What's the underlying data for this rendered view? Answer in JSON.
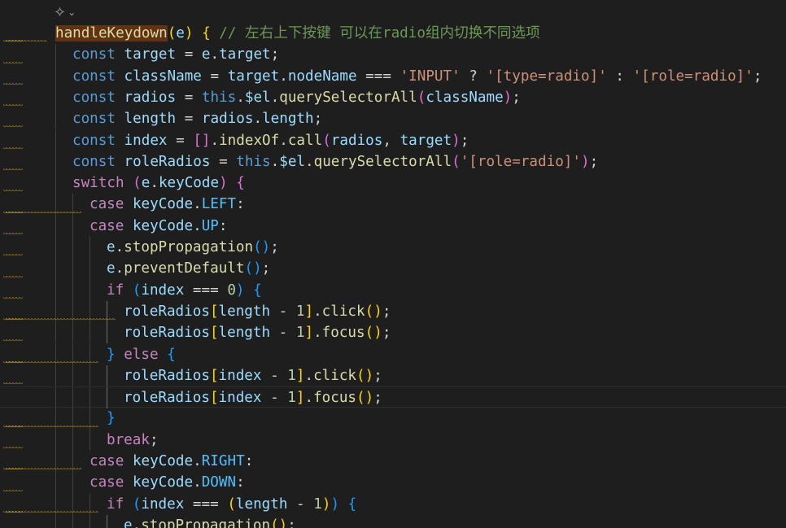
{
  "editor": {
    "fold_icon": "sparkle-icon",
    "fold_chevron": "chevron-down-icon",
    "lines": [
      {
        "indent": 1,
        "squig": "both",
        "tokens": [
          {
            "t": "handleKeydown",
            "c": "fn hl"
          },
          {
            "t": "(",
            "c": "br1"
          },
          {
            "t": "e",
            "c": "var"
          },
          {
            "t": ")",
            "c": "br1"
          },
          {
            "t": " ",
            "c": "op"
          },
          {
            "t": "{",
            "c": "br1"
          },
          {
            "t": " // 左右上下按键 可以在radio组内切换不同选项",
            "c": "com"
          }
        ]
      },
      {
        "indent": 2,
        "squig": "ln",
        "tokens": [
          {
            "t": "const",
            "c": "kw"
          },
          {
            "t": " target ",
            "c": "var"
          },
          {
            "t": "= ",
            "c": "op"
          },
          {
            "t": "e",
            "c": "var"
          },
          {
            "t": ".",
            "c": "op"
          },
          {
            "t": "target",
            "c": "var"
          },
          {
            "t": ";",
            "c": "op"
          }
        ]
      },
      {
        "indent": 2,
        "squig": "ln",
        "tokens": [
          {
            "t": "const",
            "c": "kw"
          },
          {
            "t": " className ",
            "c": "var"
          },
          {
            "t": "= ",
            "c": "op"
          },
          {
            "t": "target",
            "c": "var"
          },
          {
            "t": ".",
            "c": "op"
          },
          {
            "t": "nodeName",
            "c": "var"
          },
          {
            "t": " === ",
            "c": "op"
          },
          {
            "t": "'INPUT'",
            "c": "str"
          },
          {
            "t": " ? ",
            "c": "op"
          },
          {
            "t": "'[type=radio]'",
            "c": "str"
          },
          {
            "t": " : ",
            "c": "op"
          },
          {
            "t": "'[role=radio]'",
            "c": "str"
          },
          {
            "t": ";",
            "c": "op"
          }
        ]
      },
      {
        "indent": 2,
        "squig": "ln",
        "tokens": [
          {
            "t": "const",
            "c": "kw"
          },
          {
            "t": " radios ",
            "c": "var"
          },
          {
            "t": "= ",
            "c": "op"
          },
          {
            "t": "this",
            "c": "kw"
          },
          {
            "t": ".",
            "c": "op"
          },
          {
            "t": "$el",
            "c": "var"
          },
          {
            "t": ".",
            "c": "op"
          },
          {
            "t": "querySelectorAll",
            "c": "fn"
          },
          {
            "t": "(",
            "c": "br2"
          },
          {
            "t": "className",
            "c": "var"
          },
          {
            "t": ")",
            "c": "br2"
          },
          {
            "t": ";",
            "c": "op"
          }
        ]
      },
      {
        "indent": 2,
        "squig": "ln",
        "tokens": [
          {
            "t": "const",
            "c": "kw"
          },
          {
            "t": " length ",
            "c": "var"
          },
          {
            "t": "= ",
            "c": "op"
          },
          {
            "t": "radios",
            "c": "var"
          },
          {
            "t": ".",
            "c": "op"
          },
          {
            "t": "length",
            "c": "var"
          },
          {
            "t": ";",
            "c": "op"
          }
        ]
      },
      {
        "indent": 2,
        "squig": "ln",
        "tokens": [
          {
            "t": "const",
            "c": "kw"
          },
          {
            "t": " index ",
            "c": "var"
          },
          {
            "t": "= ",
            "c": "op"
          },
          {
            "t": "[]",
            "c": "br2"
          },
          {
            "t": ".",
            "c": "op"
          },
          {
            "t": "indexOf",
            "c": "fn"
          },
          {
            "t": ".",
            "c": "op"
          },
          {
            "t": "call",
            "c": "fn"
          },
          {
            "t": "(",
            "c": "br2"
          },
          {
            "t": "radios",
            "c": "var"
          },
          {
            "t": ", ",
            "c": "op"
          },
          {
            "t": "target",
            "c": "var"
          },
          {
            "t": ")",
            "c": "br2"
          },
          {
            "t": ";",
            "c": "op"
          }
        ]
      },
      {
        "indent": 2,
        "squig": "ln",
        "tokens": [
          {
            "t": "const",
            "c": "kw"
          },
          {
            "t": " roleRadios ",
            "c": "var"
          },
          {
            "t": "= ",
            "c": "op"
          },
          {
            "t": "this",
            "c": "kw"
          },
          {
            "t": ".",
            "c": "op"
          },
          {
            "t": "$el",
            "c": "var"
          },
          {
            "t": ".",
            "c": "op"
          },
          {
            "t": "querySelectorAll",
            "c": "fn"
          },
          {
            "t": "(",
            "c": "br2"
          },
          {
            "t": "'[role=radio]'",
            "c": "str"
          },
          {
            "t": ")",
            "c": "br2"
          },
          {
            "t": ";",
            "c": "op"
          }
        ]
      },
      {
        "indent": 2,
        "squig": "ln",
        "tokens": [
          {
            "t": "switch",
            "c": "ctrl"
          },
          {
            "t": " ",
            "c": "op"
          },
          {
            "t": "(",
            "c": "br2"
          },
          {
            "t": "e",
            "c": "var"
          },
          {
            "t": ".",
            "c": "op"
          },
          {
            "t": "keyCode",
            "c": "var"
          },
          {
            "t": ")",
            "c": "br2"
          },
          {
            "t": " ",
            "c": "op"
          },
          {
            "t": "{",
            "c": "br2"
          }
        ]
      },
      {
        "indent": 3,
        "squig": "both",
        "tokens": [
          {
            "t": "case",
            "c": "ctrl"
          },
          {
            "t": " keyCode",
            "c": "var"
          },
          {
            "t": ".",
            "c": "op"
          },
          {
            "t": "LEFT",
            "c": "con"
          },
          {
            "t": ":",
            "c": "op"
          }
        ]
      },
      {
        "indent": 3,
        "squig": "ln",
        "tokens": [
          {
            "t": "case",
            "c": "ctrl"
          },
          {
            "t": " keyCode",
            "c": "var"
          },
          {
            "t": ".",
            "c": "op"
          },
          {
            "t": "UP",
            "c": "con"
          },
          {
            "t": ":",
            "c": "op"
          }
        ]
      },
      {
        "indent": 4,
        "squig": "ln",
        "tokens": [
          {
            "t": "e",
            "c": "var"
          },
          {
            "t": ".",
            "c": "op"
          },
          {
            "t": "stopPropagation",
            "c": "fn"
          },
          {
            "t": "()",
            "c": "br3"
          },
          {
            "t": ";",
            "c": "op"
          }
        ]
      },
      {
        "indent": 4,
        "squig": "ln",
        "tokens": [
          {
            "t": "e",
            "c": "var"
          },
          {
            "t": ".",
            "c": "op"
          },
          {
            "t": "preventDefault",
            "c": "fn"
          },
          {
            "t": "()",
            "c": "br3"
          },
          {
            "t": ";",
            "c": "op"
          }
        ]
      },
      {
        "indent": 4,
        "squig": "ln",
        "tokens": [
          {
            "t": "if",
            "c": "ctrl"
          },
          {
            "t": " ",
            "c": "op"
          },
          {
            "t": "(",
            "c": "br3"
          },
          {
            "t": "index",
            "c": "var"
          },
          {
            "t": " === ",
            "c": "op"
          },
          {
            "t": "0",
            "c": "num"
          },
          {
            "t": ")",
            "c": "br3"
          },
          {
            "t": " ",
            "c": "op"
          },
          {
            "t": "{",
            "c": "br3"
          }
        ]
      },
      {
        "indent": 5,
        "squig": "both",
        "tokens": [
          {
            "t": "roleRadios",
            "c": "var"
          },
          {
            "t": "[",
            "c": "br1"
          },
          {
            "t": "length",
            "c": "var"
          },
          {
            "t": " - ",
            "c": "op"
          },
          {
            "t": "1",
            "c": "num"
          },
          {
            "t": "]",
            "c": "br1"
          },
          {
            "t": ".",
            "c": "op"
          },
          {
            "t": "click",
            "c": "fn"
          },
          {
            "t": "()",
            "c": "br1"
          },
          {
            "t": ";",
            "c": "op"
          }
        ]
      },
      {
        "indent": 5,
        "squig": "ln",
        "tokens": [
          {
            "t": "roleRadios",
            "c": "var"
          },
          {
            "t": "[",
            "c": "br1"
          },
          {
            "t": "length",
            "c": "var"
          },
          {
            "t": " - ",
            "c": "op"
          },
          {
            "t": "1",
            "c": "num"
          },
          {
            "t": "]",
            "c": "br1"
          },
          {
            "t": ".",
            "c": "op"
          },
          {
            "t": "focus",
            "c": "fn"
          },
          {
            "t": "()",
            "c": "br1"
          },
          {
            "t": ";",
            "c": "op"
          }
        ]
      },
      {
        "indent": 4,
        "squig": "both",
        "tokens": [
          {
            "t": "}",
            "c": "br3"
          },
          {
            "t": " ",
            "c": "op"
          },
          {
            "t": "else",
            "c": "ctrl"
          },
          {
            "t": " ",
            "c": "op"
          },
          {
            "t": "{",
            "c": "br3"
          }
        ]
      },
      {
        "indent": 5,
        "squig": "ln",
        "tokens": [
          {
            "t": "roleRadios",
            "c": "var"
          },
          {
            "t": "[",
            "c": "br1"
          },
          {
            "t": "index",
            "c": "var"
          },
          {
            "t": " - ",
            "c": "op"
          },
          {
            "t": "1",
            "c": "num"
          },
          {
            "t": "]",
            "c": "br1"
          },
          {
            "t": ".",
            "c": "op"
          },
          {
            "t": "click",
            "c": "fn"
          },
          {
            "t": "()",
            "c": "br1"
          },
          {
            "t": ";",
            "c": "op"
          }
        ]
      },
      {
        "indent": 5,
        "squig": "none",
        "current": true,
        "tokens": [
          {
            "t": "roleRadios",
            "c": "var"
          },
          {
            "t": "[",
            "c": "br1"
          },
          {
            "t": "index",
            "c": "var"
          },
          {
            "t": " - ",
            "c": "op"
          },
          {
            "t": "1",
            "c": "num"
          },
          {
            "t": "]",
            "c": "br1"
          },
          {
            "t": ".",
            "c": "op"
          },
          {
            "t": "focus",
            "c": "fn"
          },
          {
            "t": "()",
            "c": "br1"
          },
          {
            "t": ";",
            "c": "op"
          }
        ]
      },
      {
        "indent": 4,
        "squig": "both",
        "tokens": [
          {
            "t": "}",
            "c": "br3"
          }
        ]
      },
      {
        "indent": 4,
        "squig": "ln",
        "tokens": [
          {
            "t": "break",
            "c": "ctrl"
          },
          {
            "t": ";",
            "c": "op"
          }
        ]
      },
      {
        "indent": 3,
        "squig": "both",
        "tokens": [
          {
            "t": "case",
            "c": "ctrl"
          },
          {
            "t": " keyCode",
            "c": "var"
          },
          {
            "t": ".",
            "c": "op"
          },
          {
            "t": "RIGHT",
            "c": "con"
          },
          {
            "t": ":",
            "c": "op"
          }
        ]
      },
      {
        "indent": 3,
        "squig": "ln",
        "tokens": [
          {
            "t": "case",
            "c": "ctrl"
          },
          {
            "t": " keyCode",
            "c": "var"
          },
          {
            "t": ".",
            "c": "op"
          },
          {
            "t": "DOWN",
            "c": "con"
          },
          {
            "t": ":",
            "c": "op"
          }
        ]
      },
      {
        "indent": 4,
        "squig": "both",
        "tokens": [
          {
            "t": "if",
            "c": "ctrl"
          },
          {
            "t": " ",
            "c": "op"
          },
          {
            "t": "(",
            "c": "br3"
          },
          {
            "t": "index",
            "c": "var"
          },
          {
            "t": " === ",
            "c": "op"
          },
          {
            "t": "(",
            "c": "br1"
          },
          {
            "t": "length",
            "c": "var"
          },
          {
            "t": " - ",
            "c": "op"
          },
          {
            "t": "1",
            "c": "num"
          },
          {
            "t": ")",
            "c": "br1"
          },
          {
            "t": ")",
            "c": "br3"
          },
          {
            "t": " ",
            "c": "op"
          },
          {
            "t": "{",
            "c": "br3"
          }
        ]
      },
      {
        "indent": 5,
        "squig": "none",
        "tokens": [
          {
            "t": "e",
            "c": "var"
          },
          {
            "t": ".",
            "c": "op"
          },
          {
            "t": "stopPropagation",
            "c": "fn"
          },
          {
            "t": "()",
            "c": "br1"
          },
          {
            "t": ";",
            "c": "op"
          }
        ]
      }
    ]
  }
}
